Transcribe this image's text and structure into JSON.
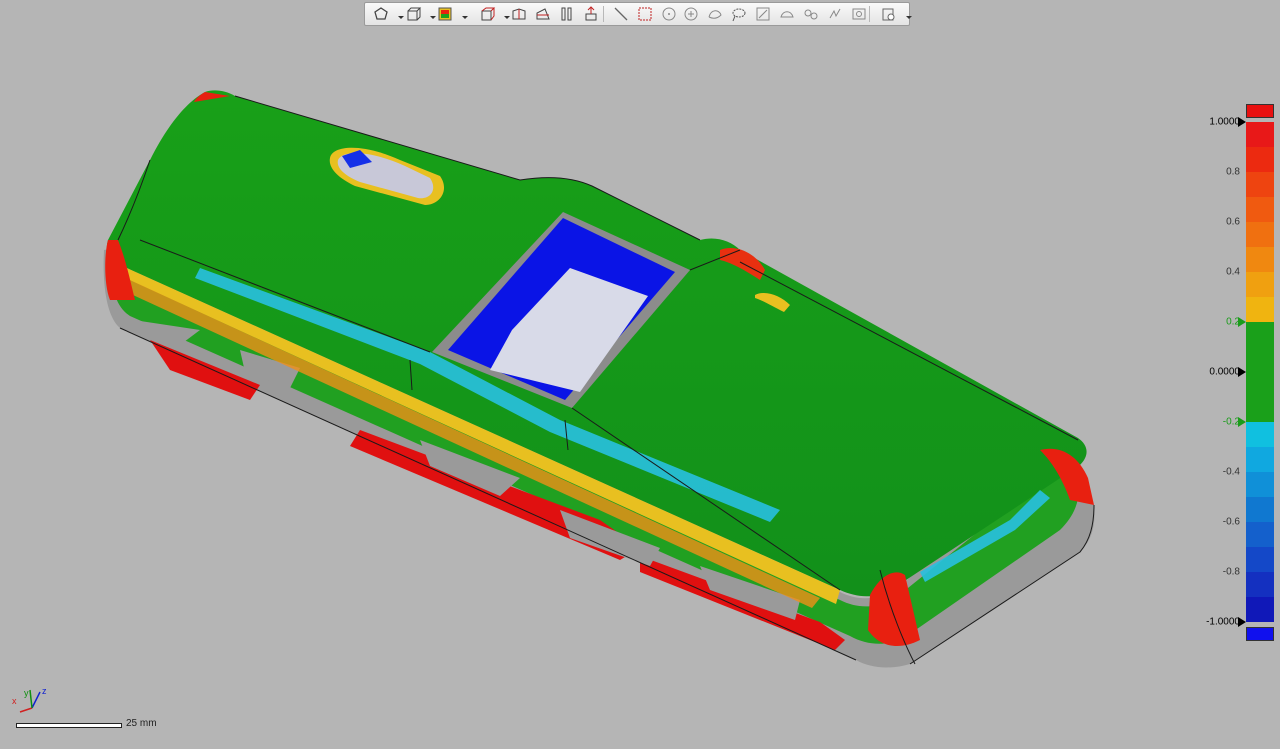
{
  "app": {
    "window_title": ""
  },
  "toolbar": {
    "tools": [
      {
        "icon": "polygon-select-icon",
        "dropdown": true
      },
      {
        "icon": "view-cube-icon",
        "dropdown": true
      },
      {
        "icon": "color-map-display-icon",
        "dropdown": true
      },
      {
        "icon": "standard-views-icon",
        "dropdown": true
      },
      {
        "icon": "section-plane-icon",
        "dropdown": false
      },
      {
        "icon": "cross-section-icon",
        "dropdown": false
      },
      {
        "icon": "parallel-planes-icon",
        "dropdown": false
      },
      {
        "icon": "datum-align-icon",
        "dropdown": false
      },
      {
        "icon": "line-tool-icon",
        "dropdown": false
      },
      {
        "icon": "rectangle-select-icon",
        "dropdown": false
      },
      {
        "icon": "circle-select-icon",
        "dropdown": false
      },
      {
        "icon": "point-select-icon",
        "dropdown": false
      },
      {
        "icon": "freeform-select-icon",
        "dropdown": false
      },
      {
        "icon": "lasso-select-icon",
        "dropdown": false
      },
      {
        "icon": "brush-select-icon",
        "dropdown": false
      },
      {
        "icon": "surface-select-icon",
        "dropdown": false
      },
      {
        "icon": "connected-select-icon",
        "dropdown": false
      },
      {
        "icon": "invert-select-icon",
        "dropdown": false
      },
      {
        "icon": "visibility-icon",
        "dropdown": false
      },
      {
        "icon": "display-options-icon",
        "dropdown": true
      }
    ]
  },
  "legend": {
    "ticks": [
      {
        "label": "1.0000",
        "value": 1.0,
        "style": "black"
      },
      {
        "label": "0.8",
        "value": 0.8,
        "style": "gray"
      },
      {
        "label": "0.6",
        "value": 0.6,
        "style": "gray"
      },
      {
        "label": "0.4",
        "value": 0.4,
        "style": "gray"
      },
      {
        "label": "0.2",
        "value": 0.2,
        "style": "green"
      },
      {
        "label": "0.0000",
        "value": 0.0,
        "style": "black"
      },
      {
        "label": "-0.2",
        "value": -0.2,
        "style": "green"
      },
      {
        "label": "-0.4",
        "value": -0.4,
        "style": "gray"
      },
      {
        "label": "-0.6",
        "value": -0.6,
        "style": "gray"
      },
      {
        "label": "-0.8",
        "value": -0.8,
        "style": "gray"
      },
      {
        "label": "-1.0000",
        "value": -1.0,
        "style": "black"
      }
    ],
    "range": [
      -1.0,
      1.0
    ],
    "tolerance": [
      -0.2,
      0.2
    ],
    "over_color": "#e81010",
    "under_color": "#1010ee",
    "tolerance_color": "#1aa01a"
  },
  "scale": {
    "label": "25 mm"
  },
  "triad": {
    "x": "x",
    "y": "y",
    "z": "z"
  },
  "colors": {
    "background": "#b5b5b5",
    "in_tolerance": "#1aa01a",
    "positive_max": "#e81010",
    "negative_max": "#0a14e6",
    "out_of_range": "#9a9a9a"
  }
}
